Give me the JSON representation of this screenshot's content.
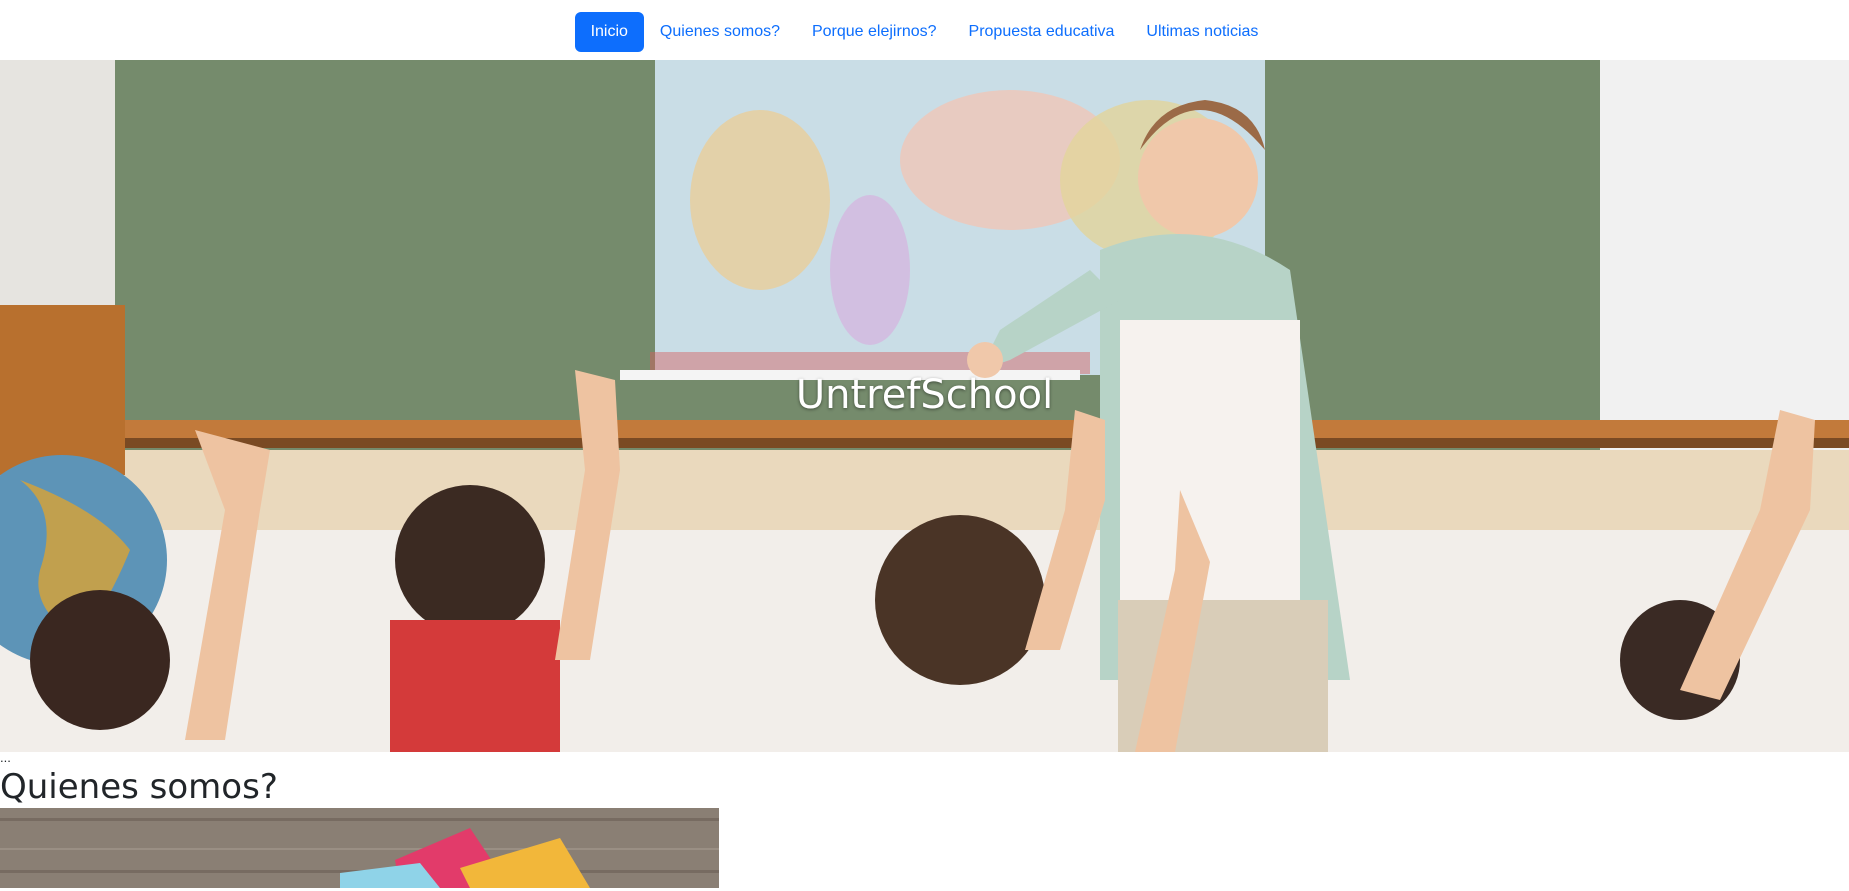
{
  "nav": {
    "items": [
      {
        "label": "Inicio",
        "active": true
      },
      {
        "label": "Quienes somos?",
        "active": false
      },
      {
        "label": "Porque elejirnos?",
        "active": false
      },
      {
        "label": "Propuesta educativa",
        "active": false
      },
      {
        "label": "Ultimas noticias",
        "active": false
      }
    ],
    "accent_color": "#0d6efd"
  },
  "hero": {
    "title": "UntrefSchool"
  },
  "content": {
    "ellipsis": "...",
    "section_title": "Quienes somos?"
  }
}
